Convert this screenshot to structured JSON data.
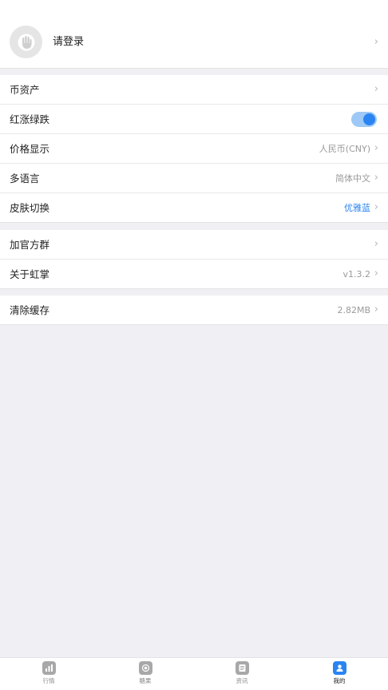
{
  "profile": {
    "login_label": "请登录",
    "chevron": "›",
    "avatar_icon": "hand-icon"
  },
  "group1": {
    "assets": {
      "label": "币资产",
      "chevron": "›"
    },
    "color_mode": {
      "label": "红涨绿跌",
      "enabled": true
    },
    "price_display": {
      "label": "价格显示",
      "value": "人民币(CNY)",
      "chevron": "›"
    },
    "language": {
      "label": "多语言",
      "value": "简体中文",
      "chevron": "›"
    },
    "skin": {
      "label": "皮肤切换",
      "value": "优雅蓝",
      "chevron": "›"
    }
  },
  "group2": {
    "join_group": {
      "label": "加官方群",
      "chevron": "›"
    },
    "about": {
      "label": "关于虹掌",
      "value": "v1.3.2",
      "chevron": "›"
    }
  },
  "group3": {
    "clear_cache": {
      "label": "清除缓存",
      "value": "2.82MB",
      "chevron": "›"
    }
  },
  "tabbar": {
    "tabs": [
      {
        "label": "行情",
        "icon": "chart-icon"
      },
      {
        "label": "糖果",
        "icon": "candy-icon"
      },
      {
        "label": "资讯",
        "icon": "news-icon"
      },
      {
        "label": "我的",
        "icon": "user-icon",
        "active": true
      }
    ]
  },
  "colors": {
    "accent": "#2a84f1",
    "background": "#efeff4"
  }
}
